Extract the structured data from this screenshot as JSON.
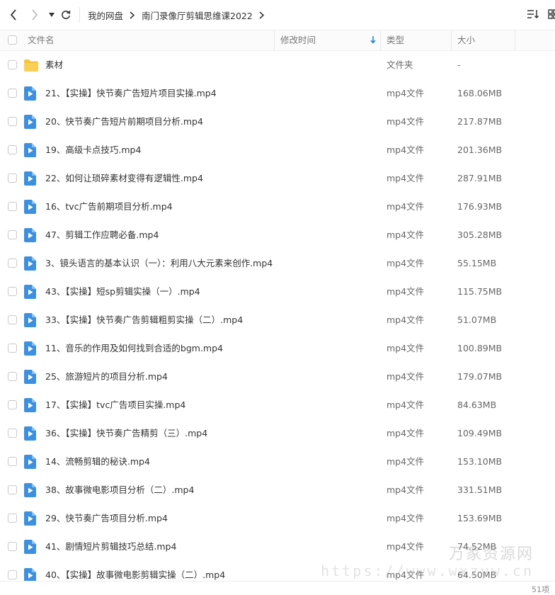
{
  "toolbar": {
    "breadcrumbs": [
      "我的网盘",
      "南门录像厅剪辑思维课2022"
    ]
  },
  "columns": {
    "name": "文件名",
    "modified": "修改时间",
    "type": "类型",
    "size": "大小"
  },
  "files": [
    {
      "name": "素材",
      "type": "文件夹",
      "size": "-",
      "kind": "folder"
    },
    {
      "name": "21、【实操】快节奏广告短片项目实操.mp4",
      "type": "mp4文件",
      "size": "168.06MB",
      "kind": "video"
    },
    {
      "name": "20、快节奏广告短片前期项目分析.mp4",
      "type": "mp4文件",
      "size": "217.87MB",
      "kind": "video"
    },
    {
      "name": "19、高级卡点技巧.mp4",
      "type": "mp4文件",
      "size": "201.36MB",
      "kind": "video"
    },
    {
      "name": "22、如何让琐碎素材变得有逻辑性.mp4",
      "type": "mp4文件",
      "size": "287.91MB",
      "kind": "video"
    },
    {
      "name": "16、tvc广告前期项目分析.mp4",
      "type": "mp4文件",
      "size": "176.93MB",
      "kind": "video"
    },
    {
      "name": "47、剪辑工作应聘必备.mp4",
      "type": "mp4文件",
      "size": "305.28MB",
      "kind": "video"
    },
    {
      "name": "3、镜头语言的基本认识（一）：利用八大元素来创作.mp4",
      "type": "mp4文件",
      "size": "55.15MB",
      "kind": "video"
    },
    {
      "name": "43、【实操】短sp剪辑实操（一）.mp4",
      "type": "mp4文件",
      "size": "115.75MB",
      "kind": "video"
    },
    {
      "name": "33、【实操】快节奏广告剪辑粗剪实操（二）.mp4",
      "type": "mp4文件",
      "size": "51.07MB",
      "kind": "video"
    },
    {
      "name": "11、音乐的作用及如何找到合适的bgm.mp4",
      "type": "mp4文件",
      "size": "100.89MB",
      "kind": "video"
    },
    {
      "name": "25、旅游短片的项目分析.mp4",
      "type": "mp4文件",
      "size": "179.07MB",
      "kind": "video"
    },
    {
      "name": "17、【实操】tvc广告项目实操.mp4",
      "type": "mp4文件",
      "size": "84.63MB",
      "kind": "video"
    },
    {
      "name": "36、【实操】快节奏广告精剪（三）.mp4",
      "type": "mp4文件",
      "size": "109.49MB",
      "kind": "video"
    },
    {
      "name": "14、流畅剪辑的秘诀.mp4",
      "type": "mp4文件",
      "size": "153.10MB",
      "kind": "video"
    },
    {
      "name": "38、故事微电影项目分析（二）.mp4",
      "type": "mp4文件",
      "size": "331.51MB",
      "kind": "video"
    },
    {
      "name": "29、快节奏广告项目分析.mp4",
      "type": "mp4文件",
      "size": "153.69MB",
      "kind": "video"
    },
    {
      "name": "41、剧情短片剪辑技巧总结.mp4",
      "type": "mp4文件",
      "size": "74.52MB",
      "kind": "video"
    },
    {
      "name": "40、【实操】故事微电影剪辑实操（二）.mp4",
      "type": "mp4文件",
      "size": "64.50MB",
      "kind": "video"
    }
  ],
  "status": {
    "count": "51项"
  },
  "watermark": {
    "name": "万家资源网",
    "url": "https://www.wxzyw.cn"
  },
  "colors": {
    "folder": "#f6c343",
    "video": "#3d8fe0",
    "sort_arrow": "#1e88e5"
  }
}
